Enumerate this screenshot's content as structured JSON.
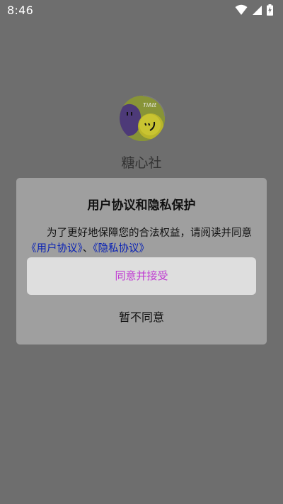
{
  "status_bar": {
    "time": "8:46",
    "icons": [
      "wifi-icon",
      "signal-icon",
      "battery-charging-icon"
    ]
  },
  "app": {
    "name": "糖心社",
    "logo_text": "TiAtt"
  },
  "dialog": {
    "title": "用户协议和隐私保护",
    "body_text": "为了更好地保障您的合法权益，请阅读并同意",
    "user_agreement_link": "《用户协议》",
    "separator": "、",
    "privacy_policy_link": "《隐私协议》",
    "accept_label": "同意并接受",
    "decline_label": "暂不同意"
  },
  "colors": {
    "overlay_background": "#6e6e6e",
    "dialog_background": "#9f9f9f",
    "accept_button_background": "#dedede",
    "accept_text": "#c03cd2",
    "link": "#0a22b5"
  }
}
